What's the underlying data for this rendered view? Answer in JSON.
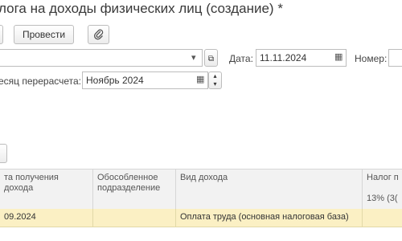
{
  "window": {
    "title": "лога на доходы физических лиц (создание) *"
  },
  "toolbar": {
    "post_label": "Провести"
  },
  "form": {
    "date_label": "Дата:",
    "date_value": "11.11.2024",
    "number_label": "Номер:",
    "recalc_label": "есяц перерасчета:",
    "recalc_value": "Ноябрь 2024"
  },
  "table": {
    "headers": {
      "col1": "та получения дохода",
      "col2": "Обособленное подразделение",
      "col3": "Вид дохода",
      "col4": "Налог п",
      "col4_sub": "13% (3("
    },
    "rows": [
      {
        "date": "09.2024",
        "division": "",
        "income_type": "Оплата труда (основная налоговая база)"
      }
    ]
  }
}
